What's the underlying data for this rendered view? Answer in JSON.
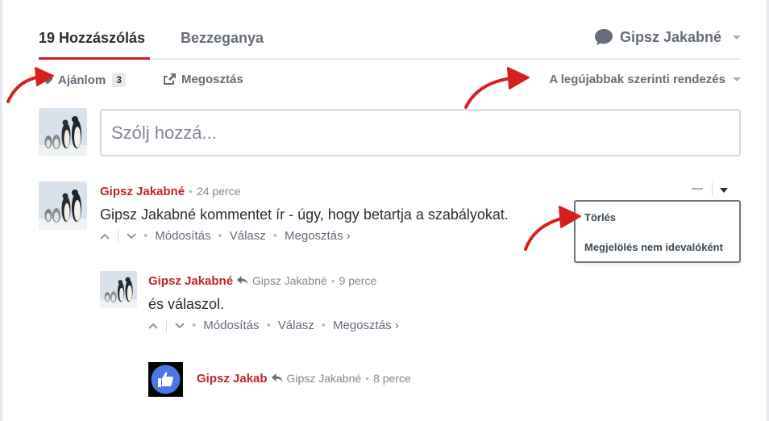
{
  "nav": {
    "comments_tab": "19 Hozzászólás",
    "community_tab": "Bezzeganya",
    "user_name": "Gipsz Jakabné"
  },
  "toolbar": {
    "recommend_label": "Ajánlom",
    "recommend_count": "3",
    "share_label": "Megosztás",
    "sort_label": "A legújabbak szerinti rendezés"
  },
  "composer": {
    "placeholder": "Szólj hozzá..."
  },
  "comments": [
    {
      "author": "Gipsz Jakabné",
      "time": "24 perce",
      "text": "Gipsz Jakabné kommentet ír - úgy, hogy betartja a szabályokat.",
      "edit": "Módosítás",
      "reply": "Válasz",
      "share": "Megosztás ›"
    },
    {
      "author": "Gipsz Jakabné",
      "reply_to": "Gipsz Jakabné",
      "time": "9 perce",
      "text": "és válaszol.",
      "edit": "Módosítás",
      "reply": "Válasz",
      "share": "Megosztás ›"
    },
    {
      "author": "Gipsz Jakab",
      "reply_to": "Gipsz Jakabné",
      "time": "8 perce"
    }
  ],
  "dropdown": {
    "delete": "Törlés",
    "flag": "Megjelölés nem idevalóként"
  },
  "colors": {
    "accent": "#c0242b",
    "muted": "#656c7a",
    "border": "#d3d8dd",
    "annotation_arrow": "#d81f20",
    "facebook_blue": "#4a77e3"
  }
}
